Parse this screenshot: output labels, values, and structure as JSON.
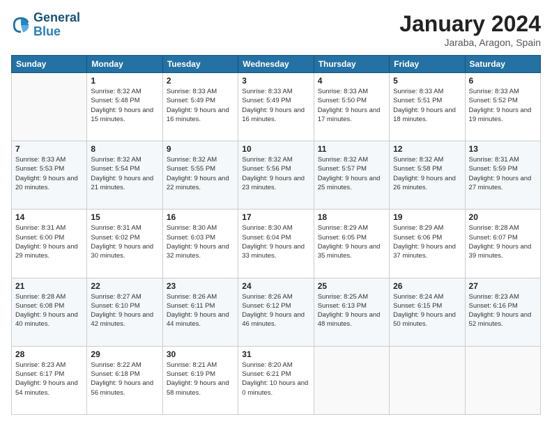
{
  "logo": {
    "line1": "General",
    "line2": "Blue"
  },
  "title": "January 2024",
  "location": "Jaraba, Aragon, Spain",
  "header": {
    "days": [
      "Sunday",
      "Monday",
      "Tuesday",
      "Wednesday",
      "Thursday",
      "Friday",
      "Saturday"
    ]
  },
  "weeks": [
    [
      {
        "day": "",
        "sunrise": "",
        "sunset": "",
        "daylight": ""
      },
      {
        "day": "1",
        "sunrise": "Sunrise: 8:32 AM",
        "sunset": "Sunset: 5:48 PM",
        "daylight": "Daylight: 9 hours and 15 minutes."
      },
      {
        "day": "2",
        "sunrise": "Sunrise: 8:33 AM",
        "sunset": "Sunset: 5:49 PM",
        "daylight": "Daylight: 9 hours and 16 minutes."
      },
      {
        "day": "3",
        "sunrise": "Sunrise: 8:33 AM",
        "sunset": "Sunset: 5:49 PM",
        "daylight": "Daylight: 9 hours and 16 minutes."
      },
      {
        "day": "4",
        "sunrise": "Sunrise: 8:33 AM",
        "sunset": "Sunset: 5:50 PM",
        "daylight": "Daylight: 9 hours and 17 minutes."
      },
      {
        "day": "5",
        "sunrise": "Sunrise: 8:33 AM",
        "sunset": "Sunset: 5:51 PM",
        "daylight": "Daylight: 9 hours and 18 minutes."
      },
      {
        "day": "6",
        "sunrise": "Sunrise: 8:33 AM",
        "sunset": "Sunset: 5:52 PM",
        "daylight": "Daylight: 9 hours and 19 minutes."
      }
    ],
    [
      {
        "day": "7",
        "sunrise": "Sunrise: 8:33 AM",
        "sunset": "Sunset: 5:53 PM",
        "daylight": "Daylight: 9 hours and 20 minutes."
      },
      {
        "day": "8",
        "sunrise": "Sunrise: 8:32 AM",
        "sunset": "Sunset: 5:54 PM",
        "daylight": "Daylight: 9 hours and 21 minutes."
      },
      {
        "day": "9",
        "sunrise": "Sunrise: 8:32 AM",
        "sunset": "Sunset: 5:55 PM",
        "daylight": "Daylight: 9 hours and 22 minutes."
      },
      {
        "day": "10",
        "sunrise": "Sunrise: 8:32 AM",
        "sunset": "Sunset: 5:56 PM",
        "daylight": "Daylight: 9 hours and 23 minutes."
      },
      {
        "day": "11",
        "sunrise": "Sunrise: 8:32 AM",
        "sunset": "Sunset: 5:57 PM",
        "daylight": "Daylight: 9 hours and 25 minutes."
      },
      {
        "day": "12",
        "sunrise": "Sunrise: 8:32 AM",
        "sunset": "Sunset: 5:58 PM",
        "daylight": "Daylight: 9 hours and 26 minutes."
      },
      {
        "day": "13",
        "sunrise": "Sunrise: 8:31 AM",
        "sunset": "Sunset: 5:59 PM",
        "daylight": "Daylight: 9 hours and 27 minutes."
      }
    ],
    [
      {
        "day": "14",
        "sunrise": "Sunrise: 8:31 AM",
        "sunset": "Sunset: 6:00 PM",
        "daylight": "Daylight: 9 hours and 29 minutes."
      },
      {
        "day": "15",
        "sunrise": "Sunrise: 8:31 AM",
        "sunset": "Sunset: 6:02 PM",
        "daylight": "Daylight: 9 hours and 30 minutes."
      },
      {
        "day": "16",
        "sunrise": "Sunrise: 8:30 AM",
        "sunset": "Sunset: 6:03 PM",
        "daylight": "Daylight: 9 hours and 32 minutes."
      },
      {
        "day": "17",
        "sunrise": "Sunrise: 8:30 AM",
        "sunset": "Sunset: 6:04 PM",
        "daylight": "Daylight: 9 hours and 33 minutes."
      },
      {
        "day": "18",
        "sunrise": "Sunrise: 8:29 AM",
        "sunset": "Sunset: 6:05 PM",
        "daylight": "Daylight: 9 hours and 35 minutes."
      },
      {
        "day": "19",
        "sunrise": "Sunrise: 8:29 AM",
        "sunset": "Sunset: 6:06 PM",
        "daylight": "Daylight: 9 hours and 37 minutes."
      },
      {
        "day": "20",
        "sunrise": "Sunrise: 8:28 AM",
        "sunset": "Sunset: 6:07 PM",
        "daylight": "Daylight: 9 hours and 39 minutes."
      }
    ],
    [
      {
        "day": "21",
        "sunrise": "Sunrise: 8:28 AM",
        "sunset": "Sunset: 6:08 PM",
        "daylight": "Daylight: 9 hours and 40 minutes."
      },
      {
        "day": "22",
        "sunrise": "Sunrise: 8:27 AM",
        "sunset": "Sunset: 6:10 PM",
        "daylight": "Daylight: 9 hours and 42 minutes."
      },
      {
        "day": "23",
        "sunrise": "Sunrise: 8:26 AM",
        "sunset": "Sunset: 6:11 PM",
        "daylight": "Daylight: 9 hours and 44 minutes."
      },
      {
        "day": "24",
        "sunrise": "Sunrise: 8:26 AM",
        "sunset": "Sunset: 6:12 PM",
        "daylight": "Daylight: 9 hours and 46 minutes."
      },
      {
        "day": "25",
        "sunrise": "Sunrise: 8:25 AM",
        "sunset": "Sunset: 6:13 PM",
        "daylight": "Daylight: 9 hours and 48 minutes."
      },
      {
        "day": "26",
        "sunrise": "Sunrise: 8:24 AM",
        "sunset": "Sunset: 6:15 PM",
        "daylight": "Daylight: 9 hours and 50 minutes."
      },
      {
        "day": "27",
        "sunrise": "Sunrise: 8:23 AM",
        "sunset": "Sunset: 6:16 PM",
        "daylight": "Daylight: 9 hours and 52 minutes."
      }
    ],
    [
      {
        "day": "28",
        "sunrise": "Sunrise: 8:23 AM",
        "sunset": "Sunset: 6:17 PM",
        "daylight": "Daylight: 9 hours and 54 minutes."
      },
      {
        "day": "29",
        "sunrise": "Sunrise: 8:22 AM",
        "sunset": "Sunset: 6:18 PM",
        "daylight": "Daylight: 9 hours and 56 minutes."
      },
      {
        "day": "30",
        "sunrise": "Sunrise: 8:21 AM",
        "sunset": "Sunset: 6:19 PM",
        "daylight": "Daylight: 9 hours and 58 minutes."
      },
      {
        "day": "31",
        "sunrise": "Sunrise: 8:20 AM",
        "sunset": "Sunset: 6:21 PM",
        "daylight": "Daylight: 10 hours and 0 minutes."
      },
      {
        "day": "",
        "sunrise": "",
        "sunset": "",
        "daylight": ""
      },
      {
        "day": "",
        "sunrise": "",
        "sunset": "",
        "daylight": ""
      },
      {
        "day": "",
        "sunrise": "",
        "sunset": "",
        "daylight": ""
      }
    ]
  ]
}
